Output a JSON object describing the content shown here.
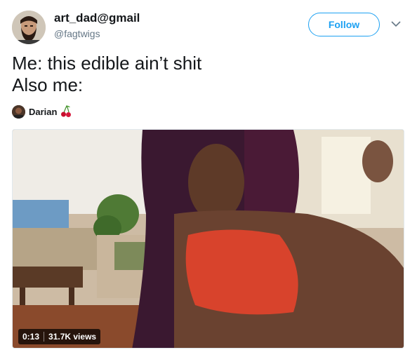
{
  "tweet": {
    "author": {
      "display_name": "art_dad@gmail",
      "handle": "@fagtwigs",
      "avatar_icon": "bearded-man-avatar"
    },
    "follow_label": "Follow",
    "menu_icon": "chevron-down-icon",
    "text_lines": [
      "Me: this edible ain’t shit",
      "Also me:"
    ],
    "credit": {
      "name": "Darian",
      "emoji_icon": "cherries-emoji"
    },
    "media": {
      "type": "video",
      "duration": "0:13",
      "views": "31.7K views"
    }
  },
  "colors": {
    "accent": "#1da1f2",
    "text": "#14171a",
    "secondary_text": "#657786"
  }
}
